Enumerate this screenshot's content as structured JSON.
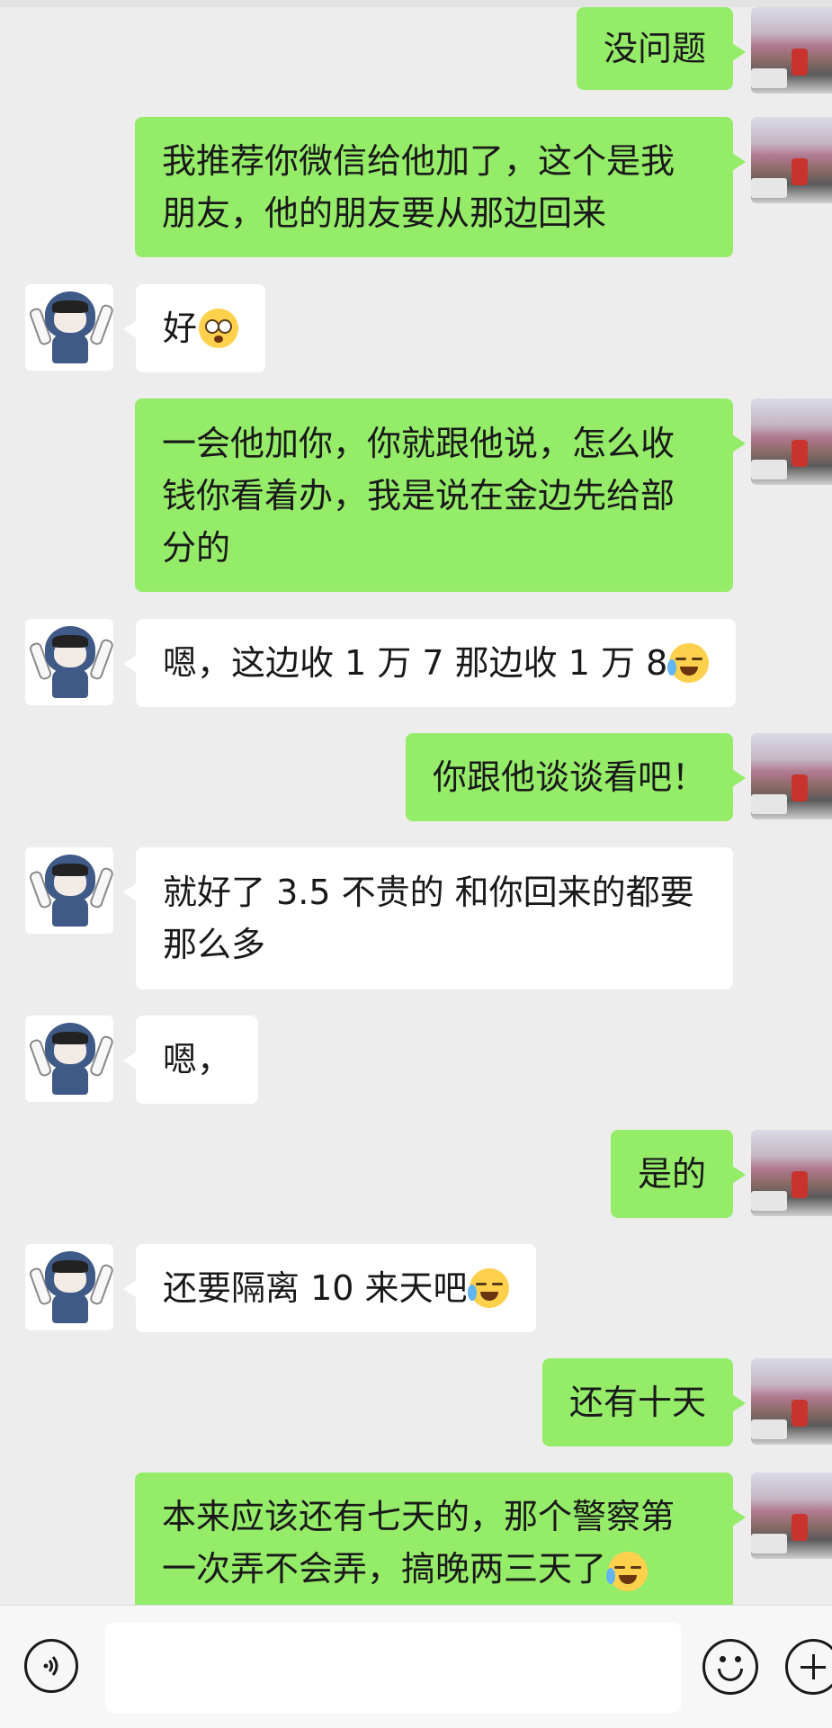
{
  "messages": [
    {
      "id": "m1",
      "sender": "me",
      "text": "没问题"
    },
    {
      "id": "m2",
      "sender": "me",
      "text": "我推荐你微信给他加了，这个是我\n朋友，他的朋友要从那边回来"
    },
    {
      "id": "m3",
      "sender": "other",
      "text": "好",
      "emoji": "flushed-face-emoji"
    },
    {
      "id": "m4",
      "sender": "me",
      "text": "一会他加你，你就跟他说，怎么收\n钱你看着办，我是说在金边先给部\n分的"
    },
    {
      "id": "m5",
      "sender": "other",
      "text": "嗯，这边收 1 万 7 那边收 1 万 8",
      "emoji": "crying-face-emoji"
    },
    {
      "id": "m6",
      "sender": "me",
      "text": "你跟他谈谈看吧！"
    },
    {
      "id": "m7",
      "sender": "other",
      "text": "就好了 3.5 不贵的 和你回来的都要\n那么多"
    },
    {
      "id": "m8",
      "sender": "other",
      "text": "嗯，"
    },
    {
      "id": "m9",
      "sender": "me",
      "text": "是的"
    },
    {
      "id": "m10",
      "sender": "other",
      "text": "还要隔离 10 来天吧",
      "emoji": "crying-face-emoji"
    },
    {
      "id": "m11",
      "sender": "me",
      "text": "还有十天"
    },
    {
      "id": "m12",
      "sender": "me",
      "text": "本来应该还有七天的，那个警察第\n一次弄不会弄，搞晚两三天了",
      "emoji": "crying-face-emoji"
    }
  ],
  "input_bar": {
    "voice_icon": "voice-icon",
    "emoji_icon": "emoji-icon",
    "plus_icon": "plus-icon",
    "message_value": ""
  },
  "colors": {
    "background": "#ededed",
    "outgoing_bubble": "#95ec69",
    "incoming_bubble": "#ffffff"
  }
}
